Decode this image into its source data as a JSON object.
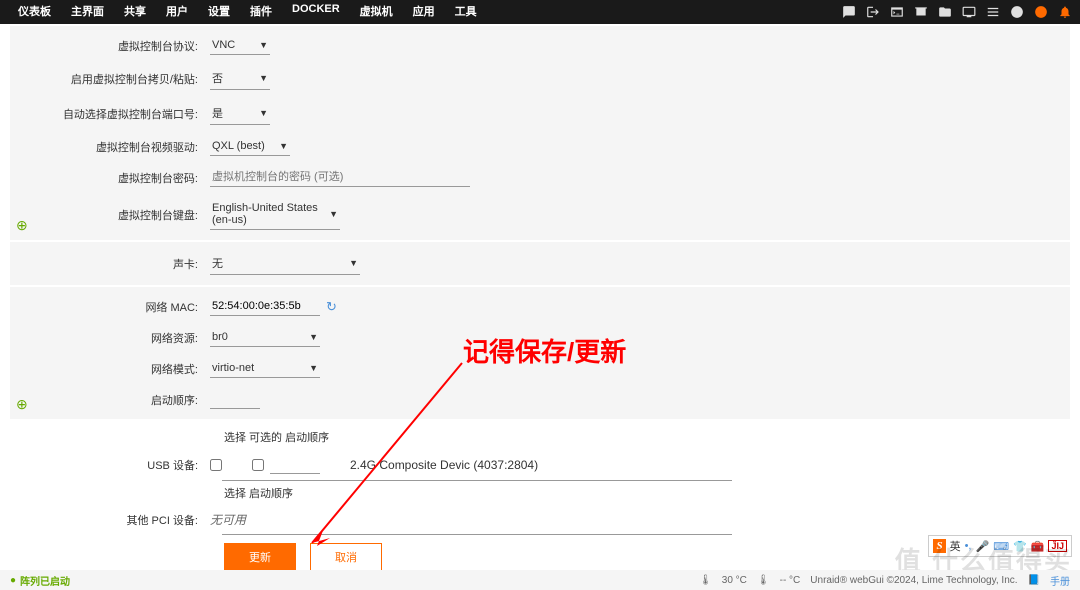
{
  "nav": {
    "items": [
      "仪表板",
      "主界面",
      "共享",
      "用户",
      "设置",
      "插件",
      "DOCKER",
      "虚拟机",
      "应用",
      "工具"
    ],
    "active": 7
  },
  "console": {
    "protocol_label": "虚拟控制台协议:",
    "protocol_value": "VNC",
    "copypaste_label": "启用虚拟控制台拷贝/粘贴:",
    "copypaste_value": "否",
    "autoport_label": "自动选择虚拟控制台端口号:",
    "autoport_value": "是",
    "video_label": "虚拟控制台视频驱动:",
    "video_value": "QXL (best)",
    "password_label": "虚拟控制台密码:",
    "password_placeholder": "虚拟机控制台的密码 (可选)",
    "keyboard_label": "虚拟控制台键盘:",
    "keyboard_value": "English-United States (en-us)"
  },
  "sound": {
    "label": "声卡:",
    "value": "无"
  },
  "network": {
    "mac_label": "网络 MAC:",
    "mac_value": "52:54:00:0e:35:5b",
    "source_label": "网络资源:",
    "source_value": "br0",
    "model_label": "网络模式:",
    "model_value": "virtio-net",
    "bootorder_label": "启动顺序:"
  },
  "usb": {
    "info1": "选择  可选的  启动顺序",
    "label": "USB 设备:",
    "device_text": "2.4G Composite Devic (4037:2804)",
    "info2": "选择  启动顺序"
  },
  "pci": {
    "label": "其他 PCI 设备:",
    "value": "无可用"
  },
  "buttons": {
    "update": "更新",
    "cancel": "取消"
  },
  "annotation": "记得保存/更新",
  "footer": {
    "status": "阵列已启动",
    "temp1": "30 °C",
    "temp2": "-- °C",
    "copyright": "Unraid® webGui ©2024, Lime Technology, Inc.",
    "manual": "手册"
  },
  "ime": {
    "lang": "英"
  },
  "watermark": "值 什么值得买"
}
